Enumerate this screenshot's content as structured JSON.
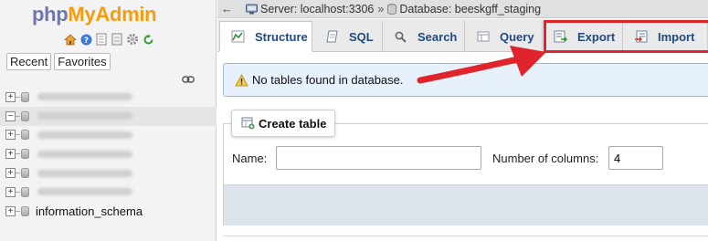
{
  "nav": {
    "logo_php": "php",
    "logo_myadmin": "MyAdmin",
    "icons": [
      "home-icon",
      "help-icon",
      "docs-icon",
      "settings-icon",
      "reload-icon"
    ],
    "tabs": [
      "Recent",
      "Favorites"
    ],
    "link_icon": "link-icon",
    "tree": [
      {
        "name": "",
        "blurred": true,
        "selected": false,
        "expander": "+"
      },
      {
        "name": "",
        "blurred": true,
        "selected": true,
        "expander": "−"
      },
      {
        "name": "",
        "blurred": true,
        "selected": false,
        "expander": "+"
      },
      {
        "name": "",
        "blurred": true,
        "selected": false,
        "expander": "+"
      },
      {
        "name": "",
        "blurred": true,
        "selected": false,
        "expander": "+"
      },
      {
        "name": "",
        "blurred": true,
        "selected": false,
        "expander": "+"
      },
      {
        "name": "information_schema",
        "blurred": false,
        "selected": false,
        "expander": "+"
      }
    ]
  },
  "breadcrumb": {
    "back_arrow": "←",
    "server": "Server: localhost:3306",
    "separator": "»",
    "database": "Database: beeskgff_staging"
  },
  "tabs": {
    "structure": "Structure",
    "sql": "SQL",
    "search": "Search",
    "query": "Query",
    "export": "Export",
    "import": "Import"
  },
  "notice": {
    "text": "No tables found in database."
  },
  "create_table": {
    "header": "Create table",
    "name_label": "Name:",
    "name_value": "",
    "columns_label": "Number of columns:",
    "columns_value": "4"
  },
  "colors": {
    "highlight": "#e0242c",
    "tab_text": "#234a80",
    "notice_bg": "#e7f1fb",
    "logo_php": "#6c78af",
    "logo_myadmin": "#f89c0e"
  }
}
